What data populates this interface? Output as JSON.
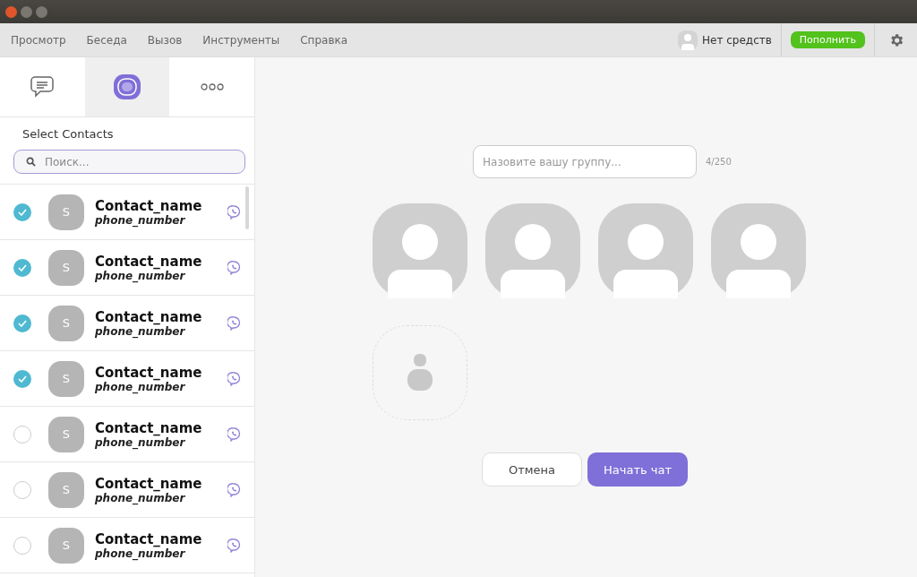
{
  "menu": [
    "Просмотр",
    "Беседа",
    "Вызов",
    "Инструменты",
    "Справка"
  ],
  "account": {
    "balance": "Нет средств",
    "topup": "Пополнить"
  },
  "tabs": [
    {
      "kind": "chats",
      "selected": false
    },
    {
      "kind": "contacts",
      "selected": true
    },
    {
      "kind": "more",
      "selected": false
    }
  ],
  "sidebar": {
    "title": "Select Contacts",
    "search": {
      "placeholder": "Поиск..."
    }
  },
  "contacts": [
    {
      "initial": "S",
      "name": "Contact_name",
      "phone": "phone_number",
      "checked": true
    },
    {
      "initial": "S",
      "name": "Contact_name",
      "phone": "phone_number",
      "checked": true
    },
    {
      "initial": "S",
      "name": "Contact_name",
      "phone": "phone_number",
      "checked": true
    },
    {
      "initial": "S",
      "name": "Contact_name",
      "phone": "phone_number",
      "checked": true
    },
    {
      "initial": "S",
      "name": "Contact_name",
      "phone": "phone_number",
      "checked": false
    },
    {
      "initial": "S",
      "name": "Contact_name",
      "phone": "phone_number",
      "checked": false
    },
    {
      "initial": "S",
      "name": "Contact_name",
      "phone": "phone_number",
      "checked": false
    }
  ],
  "group": {
    "name_placeholder": "Назовите вашу группу...",
    "counter": "4/250",
    "members": [
      {
        "kind": "placeholder"
      },
      {
        "kind": "placeholder"
      },
      {
        "kind": "placeholder"
      },
      {
        "kind": "placeholder"
      }
    ],
    "cancel": "Отмена",
    "start": "Начать чат"
  }
}
